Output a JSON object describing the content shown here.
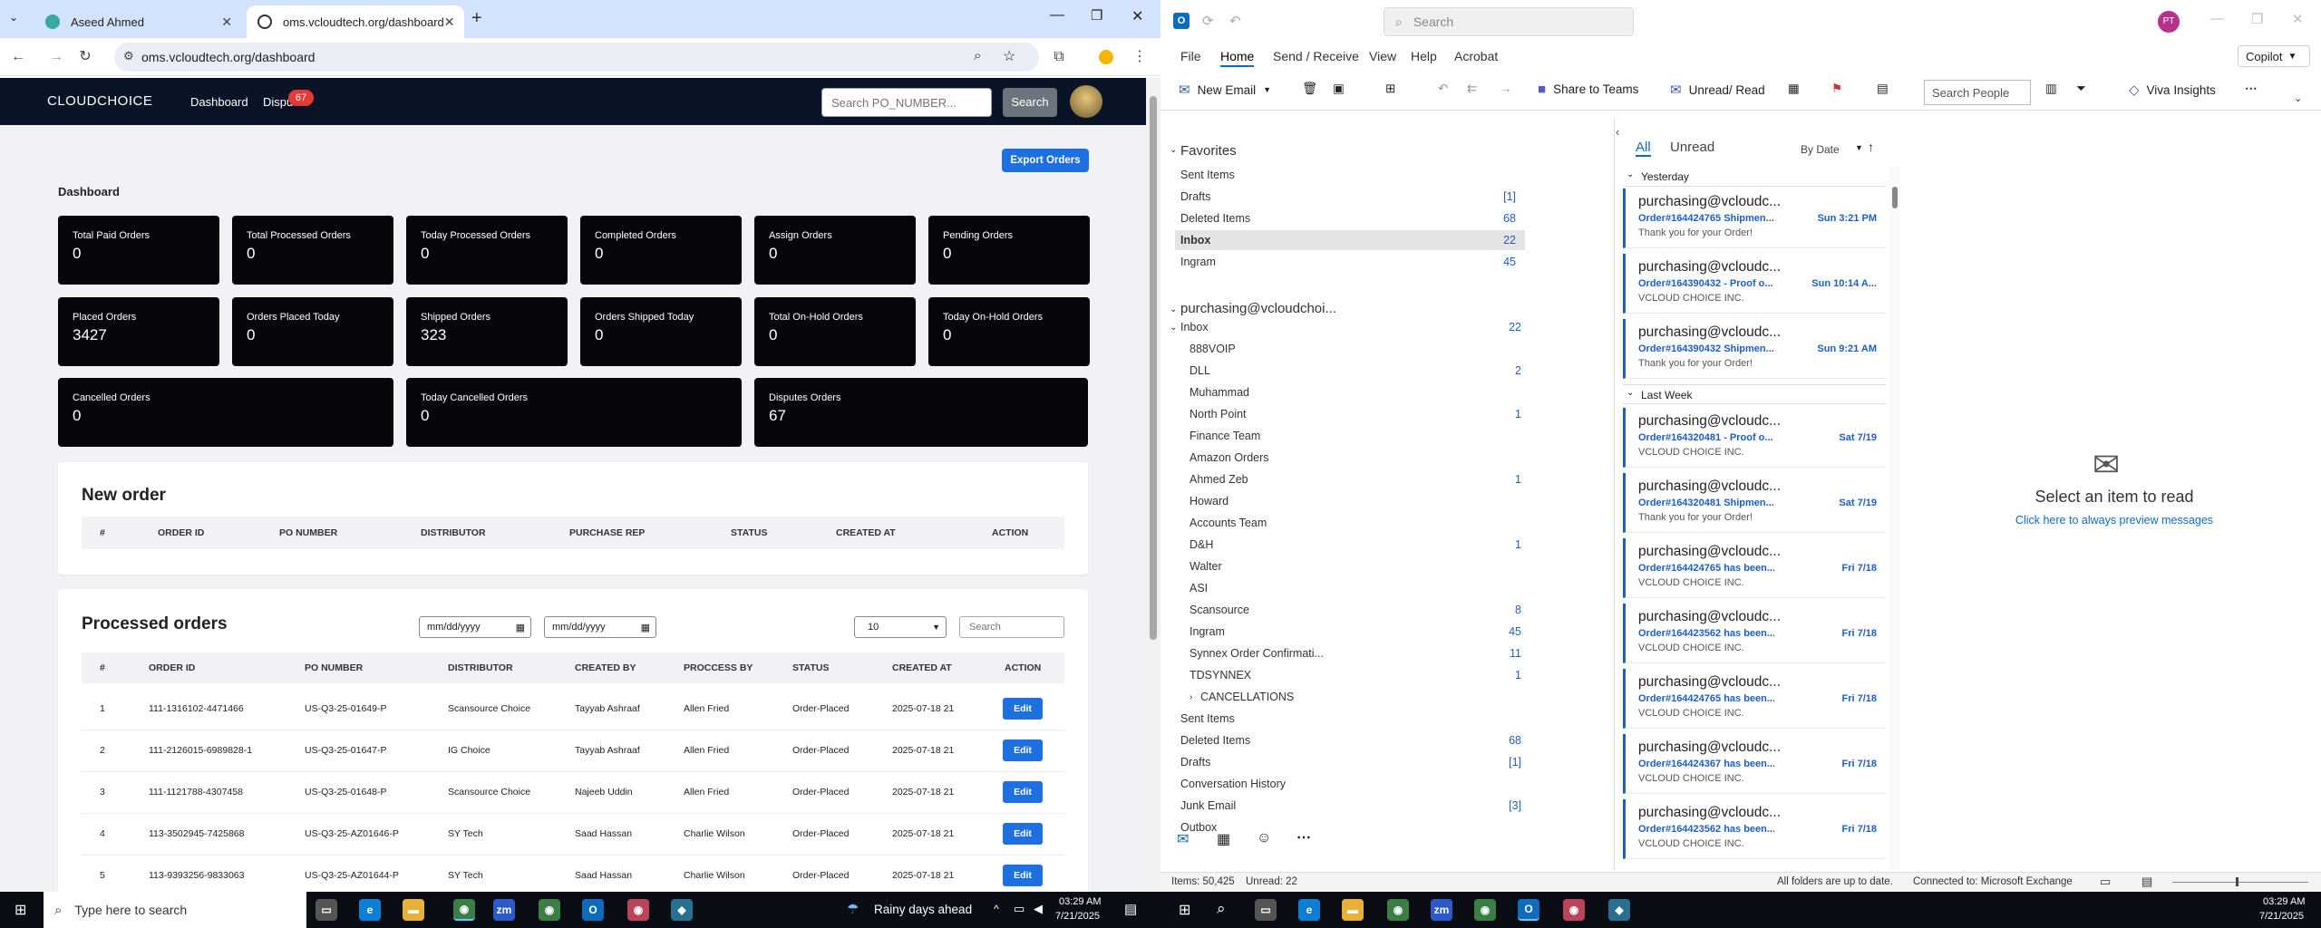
{
  "chrome": {
    "tabs": [
      {
        "title": "Aseed Ahmed",
        "active": false
      },
      {
        "title": "oms.vcloudtech.org/dashboard",
        "active": true
      }
    ],
    "url": "oms.vcloudtech.org/dashboard"
  },
  "site": {
    "logo": "CLOUDCHOICE",
    "nav": [
      "Dashboard",
      "Dispu"
    ],
    "disputes_badge": "67",
    "search_placeholder": "Search PO_NUMBER...",
    "search_button": "Search",
    "export_button": "Export Orders",
    "page_heading": "Dashboard",
    "cards": [
      {
        "label": "Total Paid Orders",
        "value": "0"
      },
      {
        "label": "Total Processed Orders",
        "value": "0"
      },
      {
        "label": "Today Processed Orders",
        "value": "0"
      },
      {
        "label": "Completed Orders",
        "value": "0"
      },
      {
        "label": "Assign Orders",
        "value": "0"
      },
      {
        "label": "Pending Orders",
        "value": "0"
      },
      {
        "label": "Placed Orders",
        "value": "3427"
      },
      {
        "label": "Orders Placed Today",
        "value": "0"
      },
      {
        "label": "Shipped Orders",
        "value": "323"
      },
      {
        "label": "Orders Shipped Today",
        "value": "0"
      },
      {
        "label": "Total On-Hold Orders",
        "value": "0"
      },
      {
        "label": "Today On-Hold Orders",
        "value": "0"
      },
      {
        "label": "Cancelled Orders",
        "value": "0"
      },
      {
        "label": "Today Cancelled Orders",
        "value": "0"
      },
      {
        "label": "Disputes Orders",
        "value": "67"
      }
    ],
    "new_order": {
      "title": "New order",
      "columns": [
        "#",
        "ORDER ID",
        "PO NUMBER",
        "DISTRIBUTOR",
        "PURCHASE REP",
        "STATUS",
        "CREATED AT",
        "ACTION"
      ]
    },
    "processed": {
      "title": "Processed orders",
      "date_from_placeholder": "mm/dd/yyyy",
      "date_to_placeholder": "mm/dd/yyyy",
      "page_size": "10",
      "search_placeholder": "Search",
      "columns": [
        "#",
        "ORDER ID",
        "PO NUMBER",
        "DISTRIBUTOR",
        "CREATED BY",
        "PROCCESS BY",
        "STATUS",
        "CREATED AT",
        "ACTION"
      ],
      "edit_label": "Edit",
      "rows": [
        [
          "1",
          "111-1316102-4471466",
          "US-Q3-25-01649-P",
          "Scansource Choice",
          "Tayyab Ashraaf",
          "Allen Fried",
          "Order-Placed",
          "2025-07-18 21"
        ],
        [
          "2",
          "111-2126015-6989828-1",
          "US-Q3-25-01647-P",
          "IG Choice",
          "Tayyab Ashraaf",
          "Allen Fried",
          "Order-Placed",
          "2025-07-18 21"
        ],
        [
          "3",
          "111-1121788-4307458",
          "US-Q3-25-01648-P",
          "Scansource Choice",
          "Najeeb Uddin",
          "Allen Fried",
          "Order-Placed",
          "2025-07-18 21"
        ],
        [
          "4",
          "113-3502945-7425868",
          "US-Q3-25-AZ01646-P",
          "SY Tech",
          "Saad Hassan",
          "Charlie Wilson",
          "Order-Placed",
          "2025-07-18 21"
        ],
        [
          "5",
          "113-9393256-9833063",
          "US-Q3-25-AZ01644-P",
          "SY Tech",
          "Saad Hassan",
          "Charlie Wilson",
          "Order-Placed",
          "2025-07-18 21"
        ]
      ]
    }
  },
  "outlook": {
    "search_placeholder": "Search",
    "avatar": "PT",
    "copilot": "Copilot",
    "menu": [
      "File",
      "Home",
      "Send / Receive",
      "View",
      "Help",
      "Acrobat"
    ],
    "ribbon": {
      "new_email": "New Email",
      "share_teams": "Share to Teams",
      "unread_read": "Unread/ Read",
      "search_people": "Search People",
      "viva": "Viva Insights"
    },
    "favorites_label": "Favorites",
    "favorites": [
      {
        "name": "Sent Items",
        "count": ""
      },
      {
        "name": "Drafts",
        "count": "[1]"
      },
      {
        "name": "Deleted Items",
        "count": "68"
      },
      {
        "name": "Inbox",
        "count": "22"
      },
      {
        "name": "Ingram",
        "count": "45"
      }
    ],
    "account": "purchasing@vcloudchoi...",
    "inbox_label": "Inbox",
    "inbox_count": "22",
    "subfolders": [
      {
        "name": "888VOIP",
        "count": ""
      },
      {
        "name": "DLL",
        "count": "2"
      },
      {
        "name": "Muhammad",
        "count": ""
      },
      {
        "name": "North Point",
        "count": "1"
      },
      {
        "name": "Finance Team",
        "count": ""
      },
      {
        "name": "Amazon Orders",
        "count": ""
      },
      {
        "name": "Ahmed Zeb",
        "count": "1"
      },
      {
        "name": "Howard",
        "count": ""
      },
      {
        "name": "Accounts Team",
        "count": ""
      },
      {
        "name": "D&H",
        "count": "1"
      },
      {
        "name": "Walter",
        "count": ""
      },
      {
        "name": "ASI",
        "count": ""
      },
      {
        "name": "Scansource",
        "count": "8"
      },
      {
        "name": "Ingram",
        "count": "45"
      },
      {
        "name": "Synnex Order Confirmati...",
        "count": "11"
      },
      {
        "name": "TDSYNNEX",
        "count": "1"
      },
      {
        "name": "CANCELLATIONS",
        "count": ""
      }
    ],
    "root_folders": [
      {
        "name": "Sent Items",
        "count": ""
      },
      {
        "name": "Deleted Items",
        "count": "68"
      },
      {
        "name": "Drafts",
        "count": "[1]"
      },
      {
        "name": "Conversation History",
        "count": ""
      },
      {
        "name": "Junk Email",
        "count": "[3]"
      },
      {
        "name": "Outbox",
        "count": ""
      }
    ],
    "list_tabs": [
      "All",
      "Unread"
    ],
    "sort": "By Date",
    "groups": [
      "Yesterday",
      "Last Week"
    ],
    "mails": [
      {
        "from": "purchasing@vcloudc...",
        "subject": "Order#164424765 Shipmen...",
        "date": "Sun 3:21 PM",
        "preview": "Thank you for your Order!"
      },
      {
        "from": "purchasing@vcloudc...",
        "subject": "Order#164390432 - Proof o...",
        "date": "Sun 10:14 A...",
        "preview": "VCLOUD CHOICE INC."
      },
      {
        "from": "purchasing@vcloudc...",
        "subject": "Order#164390432 Shipmen...",
        "date": "Sun 9:21 AM",
        "preview": "Thank you for your Order!"
      },
      {
        "from": "purchasing@vcloudc...",
        "subject": "Order#164320481 - Proof o...",
        "date": "Sat 7/19",
        "preview": "VCLOUD CHOICE INC."
      },
      {
        "from": "purchasing@vcloudc...",
        "subject": "Order#164320481 Shipmen...",
        "date": "Sat 7/19",
        "preview": "Thank you for your Order!"
      },
      {
        "from": "purchasing@vcloudc...",
        "subject": "Order#164424765 has been...",
        "date": "Fri 7/18",
        "preview": "VCLOUD CHOICE INC."
      },
      {
        "from": "purchasing@vcloudc...",
        "subject": "Order#164423562 has been...",
        "date": "Fri 7/18",
        "preview": "VCLOUD CHOICE INC."
      },
      {
        "from": "purchasing@vcloudc...",
        "subject": "Order#164424765 has been...",
        "date": "Fri 7/18",
        "preview": "VCLOUD CHOICE INC."
      },
      {
        "from": "purchasing@vcloudc...",
        "subject": "Order#164424367 has been...",
        "date": "Fri 7/18",
        "preview": "VCLOUD CHOICE INC."
      },
      {
        "from": "purchasing@vcloudc...",
        "subject": "Order#164423562 has been...",
        "date": "Fri 7/18",
        "preview": "VCLOUD CHOICE INC."
      }
    ],
    "reading_title": "Select an item to read",
    "reading_link": "Click here to always preview messages",
    "status_items": "Items: 50,425",
    "status_unread": "Unread: 22",
    "status_sync": "All folders are up to date.",
    "status_conn": "Connected to: Microsoft Exchange"
  },
  "taskbar": {
    "search_placeholder": "Type here to search",
    "weather": "Rainy days ahead",
    "time": "03:29 AM",
    "date": "7/21/2025"
  }
}
